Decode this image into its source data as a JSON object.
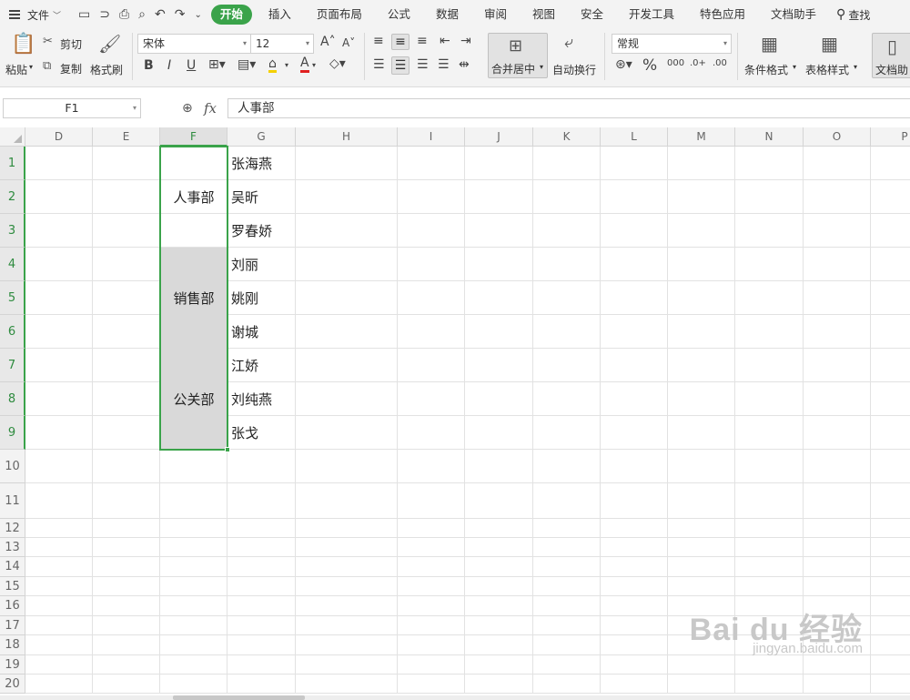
{
  "menubar": {
    "file_label": "文件",
    "tabs": [
      "开始",
      "插入",
      "页面布局",
      "公式",
      "数据",
      "审阅",
      "视图",
      "安全",
      "开发工具",
      "特色应用",
      "文档助手"
    ],
    "active_tab": "开始",
    "search_label": "查找"
  },
  "ribbon": {
    "paste": "粘贴",
    "cut": "剪切",
    "copy": "复制",
    "format_painter": "格式刷",
    "font_name": "宋体",
    "font_size": "12",
    "bold": "B",
    "italic": "I",
    "underline": "U",
    "merge_center": "合并居中",
    "wrap_text": "自动换行",
    "number_format": "常规",
    "percent": "%",
    "thousands": "000",
    "inc_decimal": ".0+",
    "dec_decimal": ".00",
    "conditional_format": "条件格式",
    "table_style": "表格样式",
    "doc_helper": "文档助"
  },
  "formula_bar": {
    "cell_ref": "F1",
    "fx": "fx",
    "content": "人事部"
  },
  "sheet": {
    "columns": [
      "D",
      "E",
      "F",
      "G",
      "H",
      "I",
      "J",
      "K",
      "L",
      "M",
      "N",
      "O",
      "P"
    ],
    "rows": [
      "1",
      "2",
      "3",
      "4",
      "5",
      "6",
      "7",
      "8",
      "9",
      "10",
      "11",
      "12",
      "13",
      "14",
      "15",
      "16",
      "17",
      "18",
      "19",
      "20"
    ],
    "selected_column": "F",
    "merged_cells": [
      {
        "label": "人事部",
        "rows": "1-3",
        "shaded": false
      },
      {
        "label": "销售部",
        "rows": "4-6",
        "shaded": true
      },
      {
        "label": "公关部",
        "rows": "7-9",
        "shaded": true
      }
    ],
    "names": [
      "张海燕",
      "吴昕",
      "罗春娇",
      "刘丽",
      "姚刚",
      "谢城",
      "江娇",
      "刘纯燕",
      "张戈"
    ]
  },
  "watermark": {
    "logo": "Bai du 经验",
    "url": "jingyan.baidu.com"
  }
}
